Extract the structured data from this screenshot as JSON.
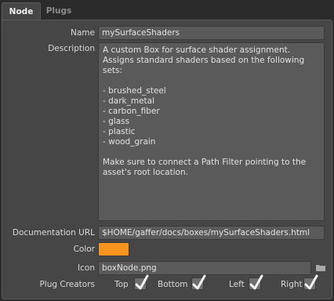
{
  "tabs": [
    {
      "label": "Node"
    },
    {
      "label": "Plugs"
    }
  ],
  "fields": {
    "name_label": "Name",
    "name_value": "mySurfaceShaders",
    "description_label": "Description",
    "description_value": "A custom Box for surface shader assignment. Assigns standard shaders based on the following sets:\n\n- brushed_steel\n- dark_metal\n- carbon_fiber\n- glass\n- plastic\n- wood_grain\n\nMake sure to connect a Path Filter pointing to the asset's root location.",
    "docurl_label": "Documentation URL",
    "docurl_value": "$HOME/gaffer/docs/boxes/mySurfaceShaders.html",
    "color_label": "Color",
    "color_value": "#f7941e",
    "icon_label": "Icon",
    "icon_value": "boxNode.png",
    "icon_browse": "folder-icon"
  },
  "plug_creators": {
    "label": "Plug Creators",
    "items": [
      {
        "label": "Top",
        "checked": true
      },
      {
        "label": "Bottom",
        "checked": true
      },
      {
        "label": "Left",
        "checked": true
      },
      {
        "label": "Right",
        "checked": true
      }
    ]
  },
  "colors": {
    "background": "#2b2b2b",
    "panel": "#464646",
    "field": "#5a5a5a",
    "accent": "#f7941e"
  }
}
